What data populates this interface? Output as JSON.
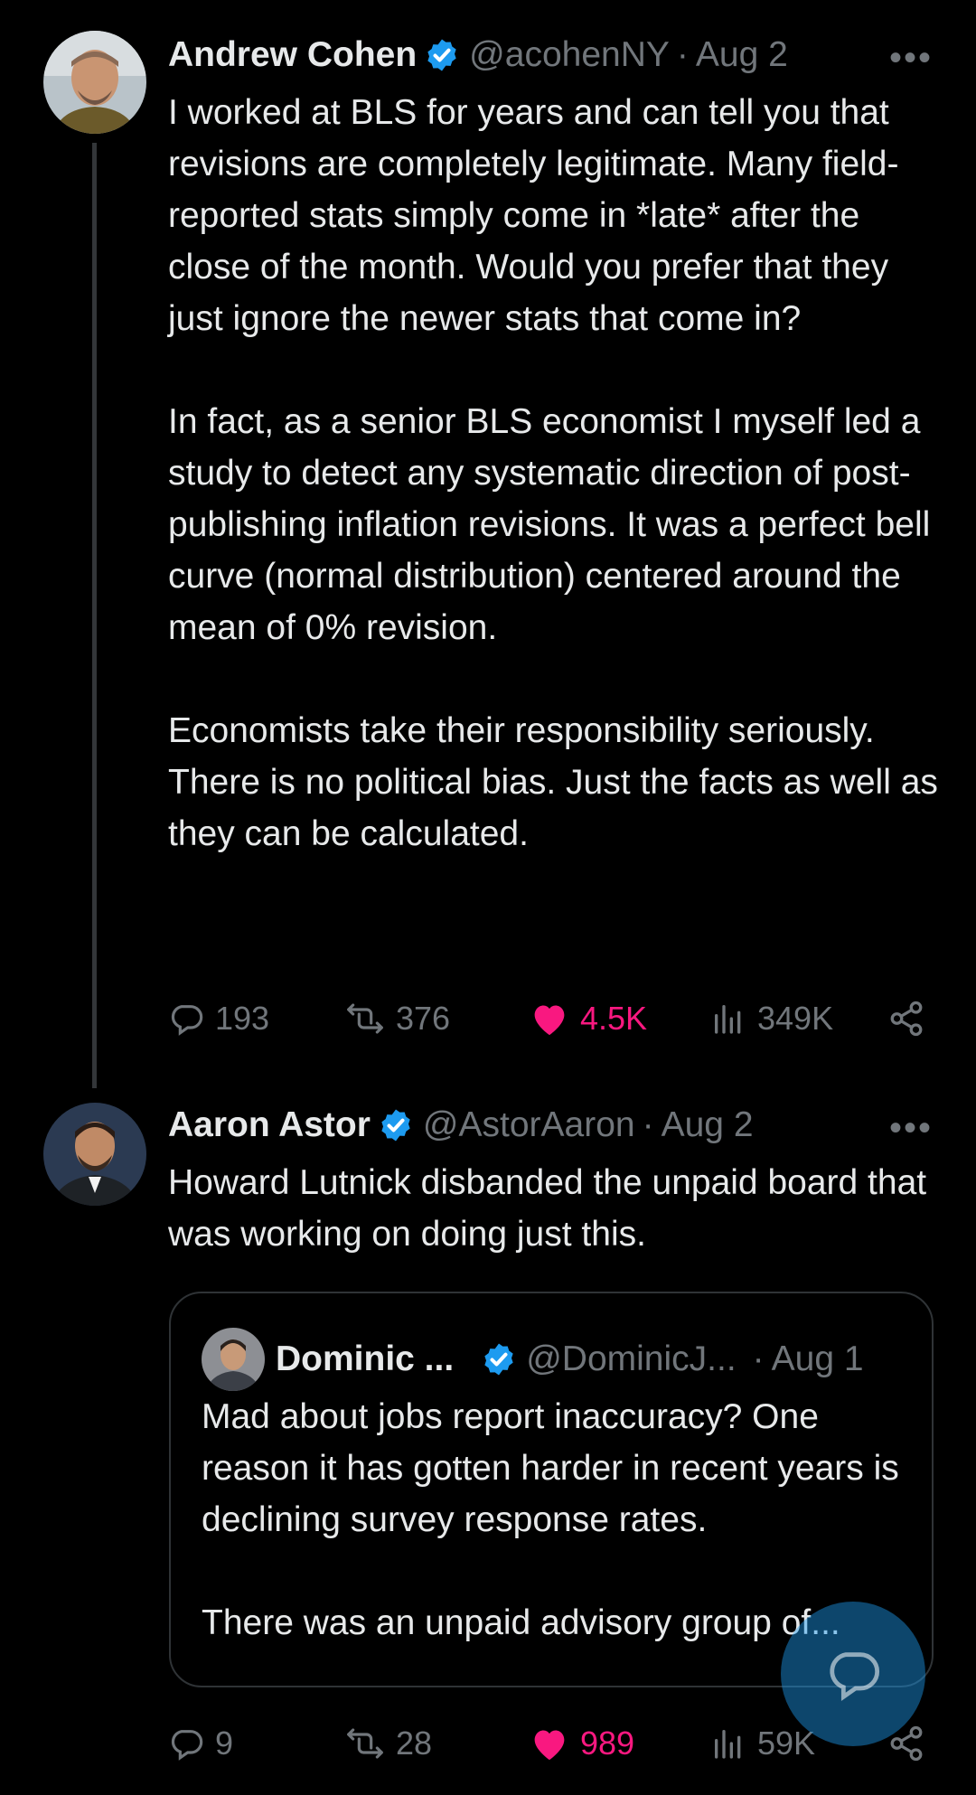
{
  "tweets": [
    {
      "name": "Andrew Cohen",
      "handle": "@acohenNY",
      "separator": "·",
      "time": "Aug 2",
      "more": "•••",
      "text": "I worked at BLS for years and can tell you that revisions are completely legitimate. Many field-reported stats simply come in *late* after the close of the month. Would you prefer that they just ignore the newer stats that come in?\n\nIn fact, as a senior BLS economist I myself led a study to detect any systematic direction of post-publishing inflation revisions. It was a perfect bell curve (normal distribution) centered around the mean of 0% revision.\n\nEconomists take their responsibility seriously. There is no political bias. Just the facts as well as they can be calculated.",
      "replies": "193",
      "reposts": "376",
      "likes": "4.5K",
      "views": "349K"
    },
    {
      "name": "Aaron Astor",
      "handle": "@AstorAaron",
      "separator": "·",
      "time": "Aug 2",
      "more": "•••",
      "text": "Howard Lutnick disbanded the unpaid board that was working on doing just this.",
      "quote": {
        "name": "Dominic ...",
        "handle": "@DominicJ...",
        "separator": "·",
        "time": "Aug 1",
        "text": "Mad about jobs report inaccuracy? One reason it has gotten harder in recent years is declining survey response rates.\n\nThere was an unpaid advisory group of..."
      },
      "replies": "9",
      "reposts": "28",
      "likes": "989",
      "views": "59K"
    }
  ],
  "colors": {
    "background": "#000000",
    "text": "#e7e9ea",
    "muted": "#71767b",
    "like": "#f91880",
    "verified": "#1d9bf0",
    "border": "#2f3336"
  },
  "icons": [
    "verified-badge-icon",
    "reply-icon",
    "repost-icon",
    "heart-icon",
    "views-icon",
    "share-icon",
    "compose-reply-icon"
  ]
}
